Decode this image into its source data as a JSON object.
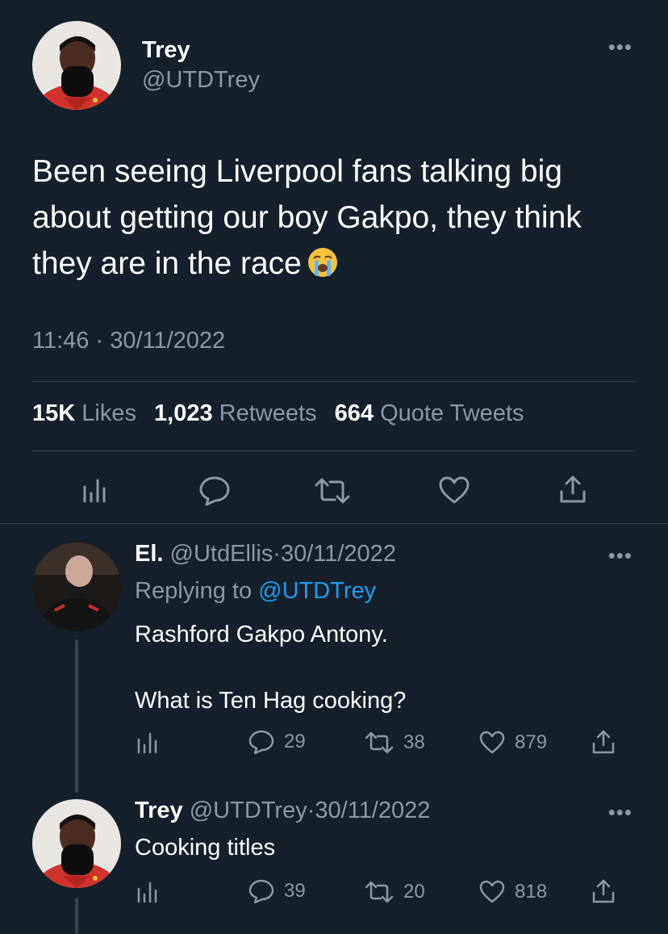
{
  "main_tweet": {
    "name": "Trey",
    "handle": "@UTDTrey",
    "text": "Been seeing Liverpool fans talking big about getting our boy Gakpo, they think they are in the race",
    "emoji": "crying-face-emoji",
    "timestamp": "11:46 · 30/11/2022",
    "stats": {
      "likes_count": "15K",
      "likes_label": "Likes",
      "retweets_count": "1,023",
      "retweets_label": "Retweets",
      "quotes_count": "664",
      "quotes_label": "Quote Tweets"
    },
    "actions": [
      "analytics-icon",
      "reply-icon",
      "retweet-icon",
      "like-icon",
      "share-icon"
    ]
  },
  "reply1": {
    "name": "El.",
    "handle": "@UtdEllis",
    "sep": "·",
    "date": "30/11/2022",
    "replying_prefix": "Replying to",
    "replying_handle": "@UTDTrey",
    "line1": "Rashford Gakpo Antony.",
    "line2": "What is Ten Hag cooking?",
    "replies": "29",
    "retweets": "38",
    "likes": "879"
  },
  "reply2": {
    "name": "Trey",
    "handle": "@UTDTrey",
    "sep": "·",
    "date": "30/11/2022",
    "text": "Cooking titles",
    "replies": "39",
    "retweets": "20",
    "likes": "818"
  },
  "colors": {
    "background": "#15202b",
    "muted": "#8b98a5",
    "accent": "#1d9bf0",
    "divider": "#38444d"
  }
}
